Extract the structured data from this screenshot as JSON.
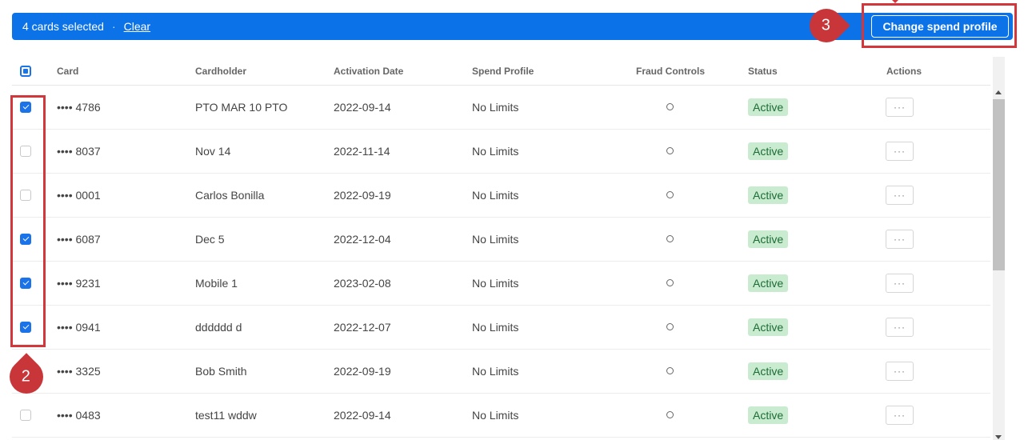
{
  "selection_bar": {
    "count_text": "4 cards selected",
    "separator": "·",
    "clear_label": "Clear",
    "change_spend_profile_label": "Change spend profile",
    "color": "#0b72e7"
  },
  "annotations": {
    "step_3": "3",
    "step_2": "2",
    "highlight_color": "#d3373c"
  },
  "table": {
    "headers": {
      "card": "Card",
      "cardholder": "Cardholder",
      "activation_date": "Activation Date",
      "spend_profile": "Spend Profile",
      "fraud_controls": "Fraud Controls",
      "status": "Status",
      "actions": "Actions"
    },
    "rows": [
      {
        "checked": true,
        "card": "•••• 4786",
        "cardholder": "PTO MAR 10 PTO",
        "activation_date": "2022-09-14",
        "spend_profile": "No Limits",
        "status": "Active",
        "actions": "···"
      },
      {
        "checked": false,
        "card": "•••• 8037",
        "cardholder": "Nov 14",
        "activation_date": "2022-11-14",
        "spend_profile": "No Limits",
        "status": "Active",
        "actions": "···"
      },
      {
        "checked": false,
        "card": "•••• 0001",
        "cardholder": "Carlos Bonilla",
        "activation_date": "2022-09-19",
        "spend_profile": "No Limits",
        "status": "Active",
        "actions": "···"
      },
      {
        "checked": true,
        "card": "•••• 6087",
        "cardholder": "Dec 5",
        "activation_date": "2022-12-04",
        "spend_profile": "No Limits",
        "status": "Active",
        "actions": "···"
      },
      {
        "checked": true,
        "card": "•••• 9231",
        "cardholder": "Mobile 1",
        "activation_date": "2023-02-08",
        "spend_profile": "No Limits",
        "status": "Active",
        "actions": "···"
      },
      {
        "checked": true,
        "card": "•••• 0941",
        "cardholder": "dddddd d",
        "activation_date": "2022-12-07",
        "spend_profile": "No Limits",
        "status": "Active",
        "actions": "···"
      },
      {
        "checked": false,
        "card": "•••• 3325",
        "cardholder": "Bob Smith",
        "activation_date": "2022-09-19",
        "spend_profile": "No Limits",
        "status": "Active",
        "actions": "···"
      },
      {
        "checked": false,
        "card": "•••• 0483",
        "cardholder": "test11 wddw",
        "activation_date": "2022-09-14",
        "spend_profile": "No Limits",
        "status": "Active",
        "actions": "···"
      }
    ]
  },
  "icons": {
    "fraud": "circle-outline-icon",
    "more": "ellipsis-icon"
  }
}
